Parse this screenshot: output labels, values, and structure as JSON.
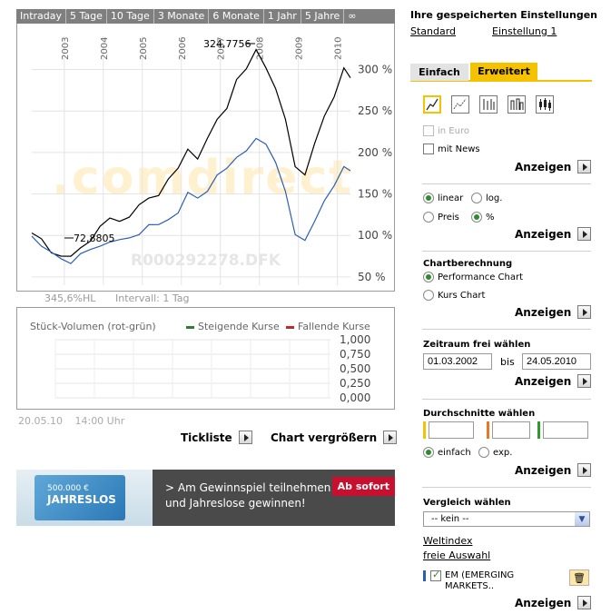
{
  "range_tabs": [
    "Intraday",
    "5 Tage",
    "10 Tage",
    "3 Monate",
    "6 Monate",
    "1 Jahr",
    "5 Jahre",
    "∞"
  ],
  "chart": {
    "watermark": ".comdirect",
    "watermark_id": "R000292278.DFK",
    "max_label": "324,7756",
    "min_label": "72,8805",
    "performance": "345,6%HL",
    "interval": "Intervall: 1 Tag",
    "colors": {
      "main": "#000000",
      "compare": "#2b5fb4",
      "grid": "#e4e4e4"
    }
  },
  "chart_data": {
    "type": "line",
    "x_ticks": [
      "2003",
      "2004",
      "2005",
      "2006",
      "2007",
      "2008",
      "2009",
      "2010"
    ],
    "y_ticks": [
      "300 %",
      "250 %",
      "200 %",
      "150 %",
      "100 %",
      "50 %"
    ],
    "ylim": [
      40,
      340
    ],
    "x_range": [
      "2002-03",
      "2010-05"
    ],
    "series": [
      {
        "color": "#000000",
        "x": [
          "2002-03",
          "2002-06",
          "2002-09",
          "2002-12",
          "2003-03",
          "2003-06",
          "2003-09",
          "2003-12",
          "2004-03",
          "2004-06",
          "2004-09",
          "2004-12",
          "2005-03",
          "2005-06",
          "2005-09",
          "2005-12",
          "2006-03",
          "2006-06",
          "2006-09",
          "2006-12",
          "2007-03",
          "2007-06",
          "2007-09",
          "2007-12",
          "2008-03",
          "2008-06",
          "2008-09",
          "2008-12",
          "2009-03",
          "2009-06",
          "2009-09",
          "2009-12",
          "2010-03",
          "2010-05"
        ],
        "y": [
          100,
          95,
          80,
          78,
          73,
          85,
          95,
          108,
          120,
          118,
          125,
          135,
          145,
          150,
          165,
          180,
          205,
          195,
          215,
          240,
          255,
          285,
          300,
          325,
          305,
          275,
          240,
          185,
          170,
          210,
          245,
          270,
          300,
          290
        ]
      },
      {
        "color": "#2b5fb4",
        "x": [
          "2002-03",
          "2002-06",
          "2002-09",
          "2002-12",
          "2003-03",
          "2003-06",
          "2003-09",
          "2003-12",
          "2004-03",
          "2004-06",
          "2004-09",
          "2004-12",
          "2005-03",
          "2005-06",
          "2005-09",
          "2005-12",
          "2006-03",
          "2006-06",
          "2006-09",
          "2006-12",
          "2007-03",
          "2007-06",
          "2007-09",
          "2007-12",
          "2008-03",
          "2008-06",
          "2008-09",
          "2008-12",
          "2009-03",
          "2009-06",
          "2009-09",
          "2009-12",
          "2010-03",
          "2010-05"
        ],
        "y": [
          100,
          90,
          78,
          72,
          68,
          75,
          82,
          88,
          95,
          93,
          97,
          103,
          110,
          112,
          120,
          130,
          150,
          145,
          155,
          170,
          180,
          195,
          205,
          215,
          210,
          190,
          150,
          100,
          95,
          120,
          140,
          160,
          185,
          175
        ]
      }
    ]
  },
  "volume": {
    "title": "Stück-Volumen (rot-grün)",
    "legend_up": "Steigende Kurse",
    "legend_down": "Fallende Kurse",
    "ticks": [
      "1,000",
      "0,750",
      "0,500",
      "0,250",
      "0,000"
    ],
    "colors": {
      "up": "#2e7d32",
      "down": "#c62828"
    }
  },
  "datetime": {
    "date": "20.05.10",
    "time": "14:00 Uhr"
  },
  "links": {
    "ticks": "Tickliste",
    "enlarge": "Chart vergrößern"
  },
  "banner": {
    "card_line1": "500.000 €",
    "card_line2": "JAHRESLOS",
    "text_line1": "> Am Gewinnspiel teilnehmen",
    "text_line2": "und Jahreslose gewinnen!",
    "badge": "Ab sofort"
  },
  "panel": {
    "saved_title": "Ihre gespeicherten Einstellungen",
    "saved_standard": "Standard",
    "saved_setting1": "Einstellung 1",
    "tab_simple": "Einfach",
    "tab_advanced": "Erweitert",
    "in_euro": "in Euro",
    "with_news": "mit News",
    "show": "Anzeigen",
    "linear": "linear",
    "log": "log.",
    "price": "Preis",
    "percent": "%",
    "calc_title": "Chartberechnung",
    "perf_chart": "Performance Chart",
    "price_chart": "Kurs Chart",
    "period_title": "Zeitraum frei wählen",
    "from": "01.03.2002",
    "bis": "bis",
    "to": "24.05.2010",
    "avg_title": "Durchschnitte wählen",
    "simple": "einfach",
    "exp": "exp.",
    "compare_title": "Vergleich wählen",
    "compare_select": "-- kein --",
    "world_index": "Weltindex",
    "free_choice": "freie Auswahl",
    "compare_item": "EM (EMERGING MARKETS..",
    "avg_colors": [
      "#f4c200",
      "#e87722",
      "#2e9b2e"
    ]
  }
}
